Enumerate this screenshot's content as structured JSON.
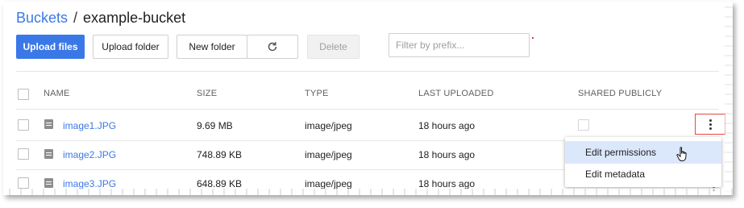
{
  "breadcrumb": {
    "root": "Buckets",
    "separator": "/",
    "current": "example-bucket"
  },
  "toolbar": {
    "upload_files": "Upload files",
    "upload_folder": "Upload folder",
    "new_folder": "New folder",
    "refresh_icon": "refresh-icon",
    "delete": "Delete"
  },
  "filter": {
    "placeholder": "Filter by prefix...",
    "value": ""
  },
  "table": {
    "columns": [
      "NAME",
      "SIZE",
      "TYPE",
      "LAST UPLOADED",
      "SHARED PUBLICLY"
    ],
    "rows": [
      {
        "name": "image1.JPG",
        "size": "9.69 MB",
        "type": "image/jpeg",
        "uploaded": "18 hours ago"
      },
      {
        "name": "image2.JPG",
        "size": "748.89 KB",
        "type": "image/jpeg",
        "uploaded": "18 hours ago"
      },
      {
        "name": "image3.JPG",
        "size": "648.89 KB",
        "type": "image/jpeg",
        "uploaded": "18 hours ago"
      }
    ]
  },
  "menu": {
    "items": [
      "Edit permissions",
      "Edit metadata"
    ]
  },
  "colors": {
    "accent": "#3b78e7",
    "highlight": "#dbe7fb",
    "kebab_border": "#e04a3f"
  }
}
